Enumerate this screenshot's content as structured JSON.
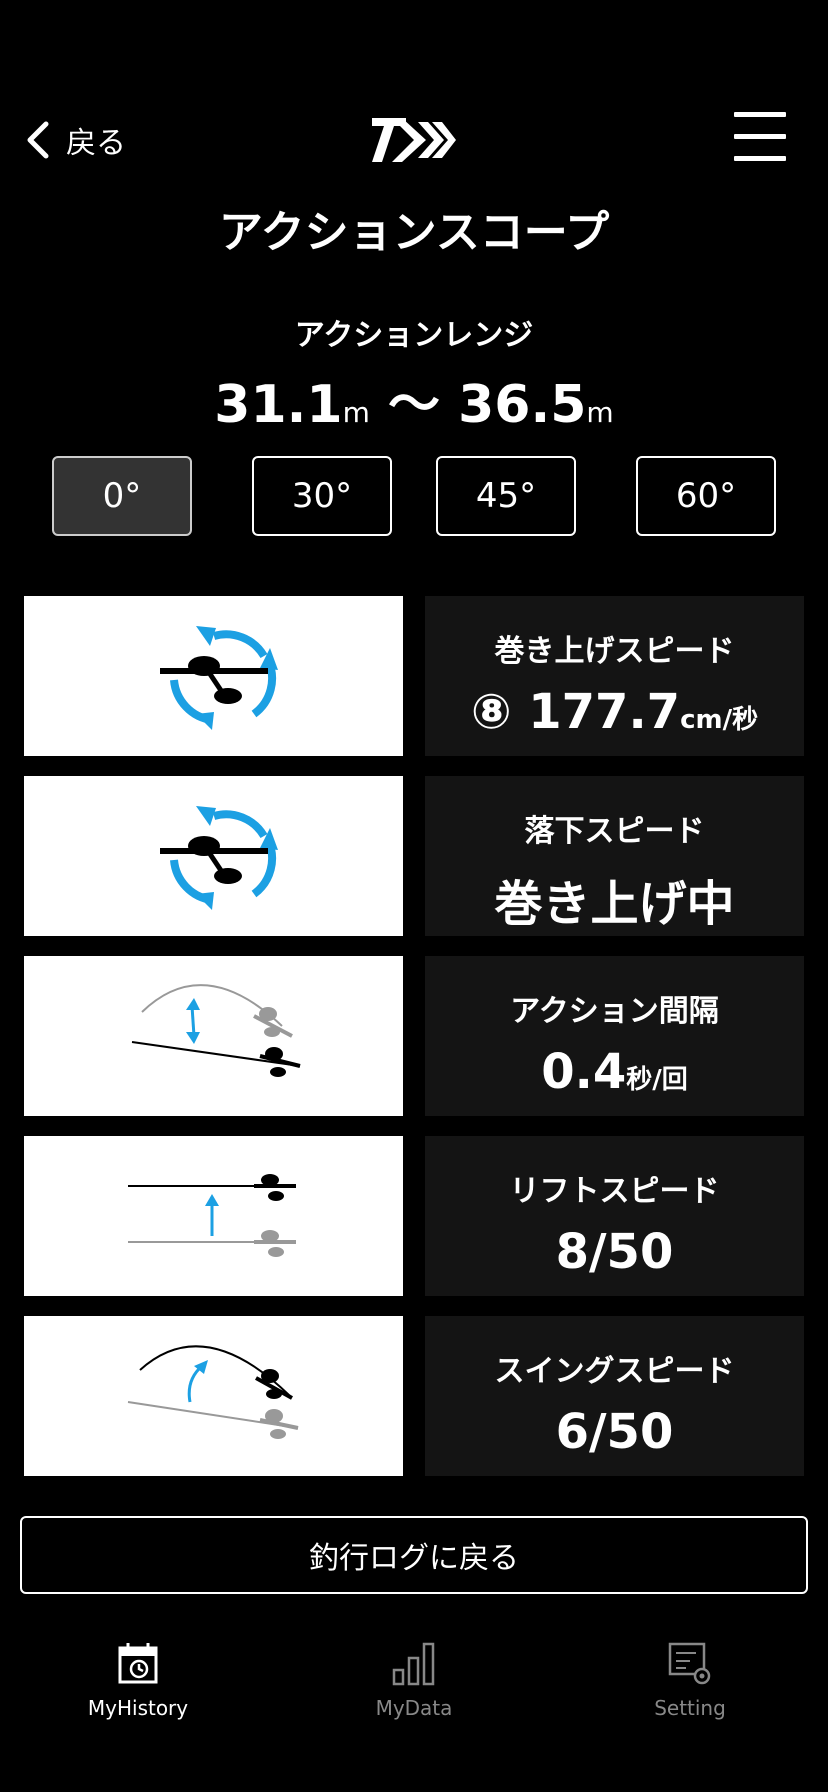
{
  "header": {
    "back_label": "戻る",
    "brand": "DAIWA",
    "menu": "menu-icon"
  },
  "title": "アクションスコープ",
  "action_range": {
    "label": "アクションレンジ",
    "from": "31.1",
    "to": "36.5",
    "unit": "m",
    "separator": "〜"
  },
  "angles": {
    "items": [
      "0°",
      "30°",
      "45°",
      "60°"
    ],
    "selected": "0°"
  },
  "metrics": [
    {
      "label": "巻き上げスピード",
      "prefix": "⑧",
      "value": "177.7",
      "unit": "cm/秒",
      "icon": "reel-winding-icon"
    },
    {
      "label": "落下スピード",
      "value": "巻き上げ中",
      "icon": "reel-winding-icon"
    },
    {
      "label": "アクション間隔",
      "value": "0.4",
      "unit": "秒/回",
      "icon": "rod-action-icon"
    },
    {
      "label": "リフトスピード",
      "value": "8/50",
      "icon": "rod-lift-icon"
    },
    {
      "label": "スイングスピード",
      "value": "6/50",
      "icon": "rod-swing-icon"
    }
  ],
  "return_button": "釣行ログに戻る",
  "tabs": [
    {
      "label": "MyHistory",
      "icon": "calendar-history-icon",
      "active": true
    },
    {
      "label": "MyData",
      "icon": "bar-chart-icon",
      "active": false
    },
    {
      "label": "Setting",
      "icon": "settings-sliders-icon",
      "active": false
    }
  ],
  "colors": {
    "background": "#000000",
    "card": "#141414",
    "accent_blue": "#1ca0e3",
    "inactive": "#888888"
  }
}
